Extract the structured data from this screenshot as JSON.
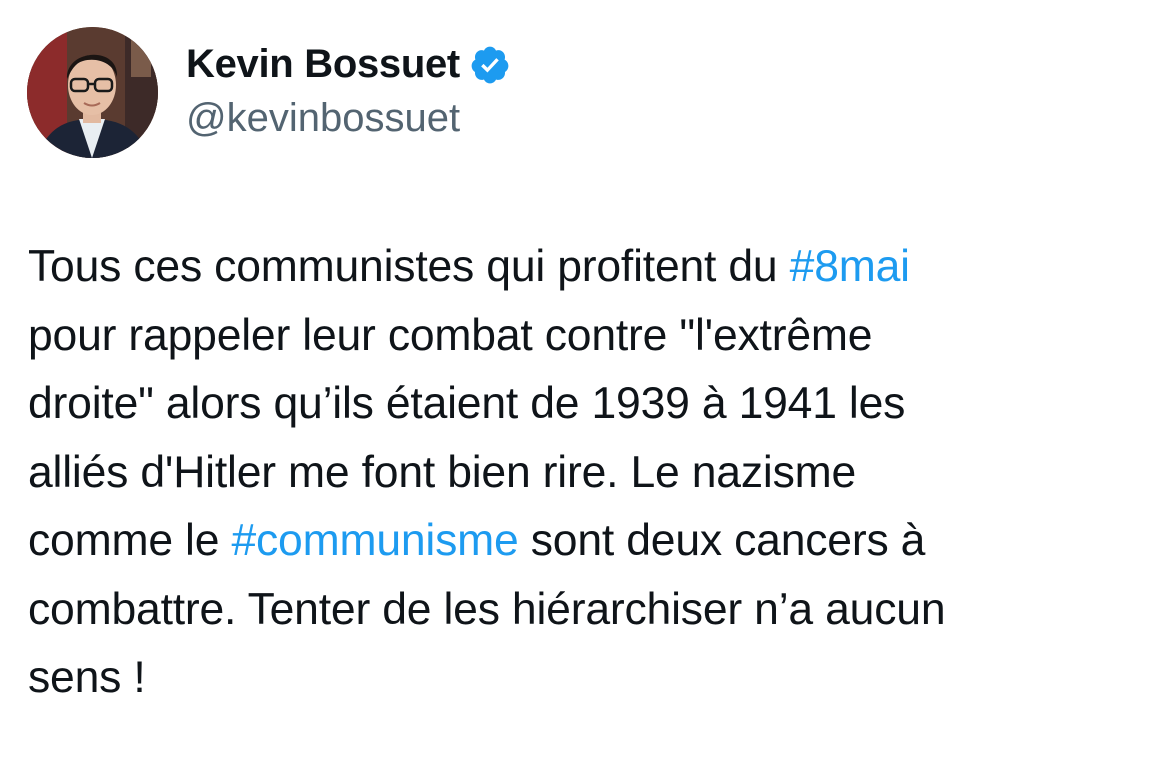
{
  "author": {
    "display_name": "Kevin Bossuet",
    "handle": "@kevinbossuet",
    "verified": true,
    "verified_icon": "verified-badge-icon",
    "avatar_icon": "avatar-photo"
  },
  "colors": {
    "text": "#0f1419",
    "secondary_text": "#536471",
    "hashtag": "#1d9bf0",
    "verified": "#1d9bf0",
    "background": "#ffffff"
  },
  "tweet": {
    "lines": [
      [
        {
          "text": "Tous ces communistes qui profitent du ",
          "type": "text"
        },
        {
          "text": "#8mai",
          "type": "hashtag"
        }
      ],
      [
        {
          "text": "pour rappeler leur combat contre \"l'extrême",
          "type": "text"
        }
      ],
      [
        {
          "text": "droite\" alors qu’ils étaient de 1939 à 1941 les",
          "type": "text"
        }
      ],
      [
        {
          "text": "alliés d'Hitler me font bien rire. Le nazisme",
          "type": "text"
        }
      ],
      [
        {
          "text": "comme le ",
          "type": "text"
        },
        {
          "text": "#communisme",
          "type": "hashtag"
        },
        {
          "text": " sont deux cancers à",
          "type": "text"
        }
      ],
      [
        {
          "text": "combattre. Tenter de les hiérarchiser n’a aucun",
          "type": "text"
        }
      ],
      [
        {
          "text": "sens !",
          "type": "text"
        }
      ]
    ]
  }
}
